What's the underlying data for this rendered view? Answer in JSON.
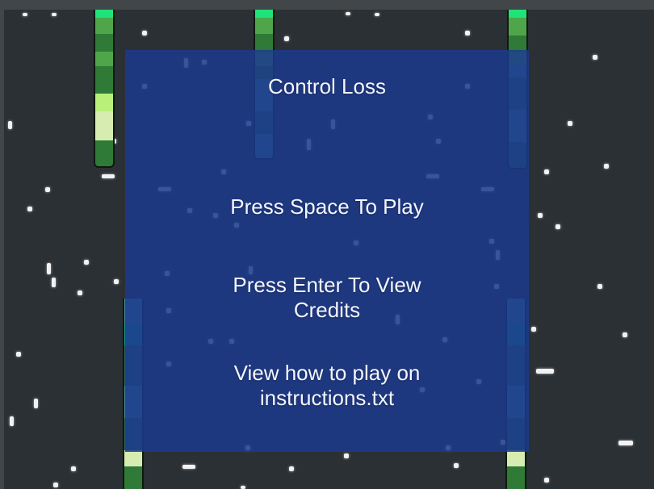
{
  "menu": {
    "title": "Control Loss",
    "play_prompt": "Press Space To Play",
    "credits_prompt": "Press Enter To View\nCredits",
    "instructions_prompt": "View how to play on\ninstructions.txt"
  },
  "colors": {
    "background": "#2b3034",
    "overlay": "#1c3a8c",
    "text": "#f4f6ff",
    "pillar_palette": [
      "#1ee37a",
      "#4fa54a",
      "#2f7a36",
      "#b8f07a",
      "#d6ecb0",
      "#1a9e8e",
      "#4a8f9a",
      "#2e6a5c"
    ]
  }
}
